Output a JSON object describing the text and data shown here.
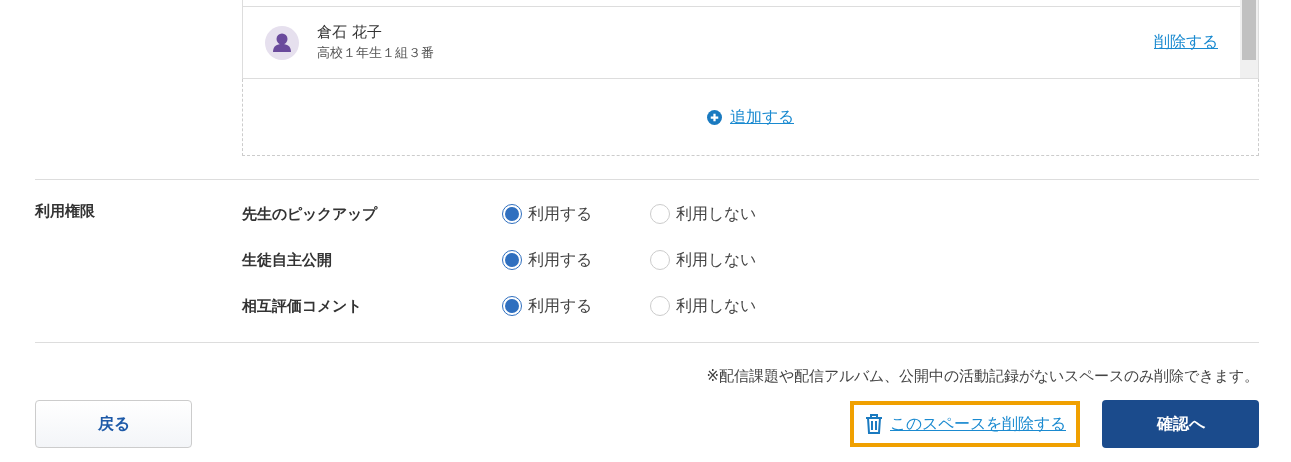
{
  "members": [
    {
      "name": "倉石 花子",
      "detail": "高校１年生１組３番",
      "action": "削除する"
    }
  ],
  "add_link": "追加する",
  "permissions": {
    "heading": "利用権限",
    "rows": [
      {
        "label": "先生のピックアップ",
        "options": [
          {
            "label": "利用する",
            "selected": true
          },
          {
            "label": "利用しない",
            "selected": false
          }
        ]
      },
      {
        "label": "生徒自主公開",
        "options": [
          {
            "label": "利用する",
            "selected": true
          },
          {
            "label": "利用しない",
            "selected": false
          }
        ]
      },
      {
        "label": "相互評価コメント",
        "options": [
          {
            "label": "利用する",
            "selected": true
          },
          {
            "label": "利用しない",
            "selected": false
          }
        ]
      }
    ]
  },
  "note": "※配信課題や配信アルバム、公開中の活動記録がないスペースのみ削除できます。",
  "back_button": "戻る",
  "delete_link": {
    "label": "このスペースを削除する",
    "highlighted": true
  },
  "confirm_button": "確認へ"
}
